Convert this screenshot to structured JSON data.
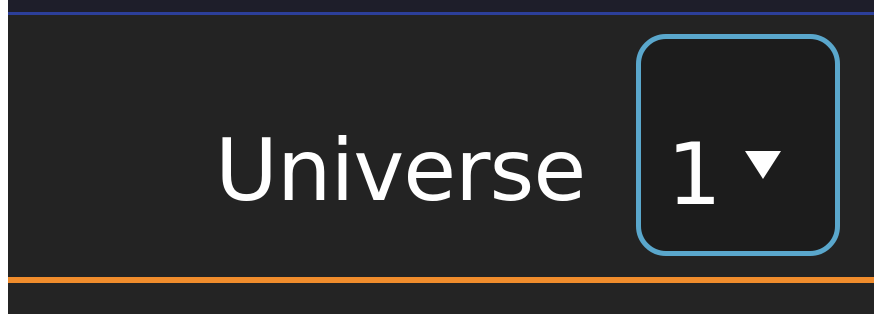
{
  "toolbar": {
    "universe_label": "Universe",
    "universe_selector": {
      "selected_value": "1",
      "icon": "chevron-down-icon"
    }
  },
  "colors": {
    "background": "#232323",
    "selector_focus_ring": "#5aa7cc",
    "accent_rule": "#f08c2c",
    "top_line": "#2c3f9a",
    "text": "#ffffff"
  }
}
